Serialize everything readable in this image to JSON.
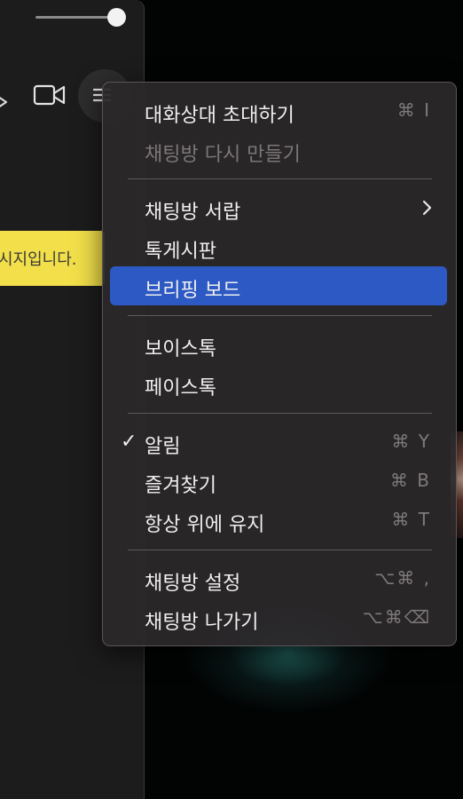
{
  "colors": {
    "menu_bg": "#2c282a",
    "highlight": "#2d59c4",
    "bubble": "#f2df4a",
    "chat_bg": "#1c1c1c"
  },
  "chat": {
    "bubble_text": "시지입니다.",
    "volume_level": 0.88
  },
  "menu": {
    "items": [
      {
        "label": "대화상대 초대하기",
        "shortcut": "⌘ I"
      },
      {
        "label": "채팅방 다시 만들기",
        "shortcut": ""
      },
      {
        "label": "채팅방 서랍",
        "shortcut": ""
      },
      {
        "label": "톡게시판",
        "shortcut": ""
      },
      {
        "label": "브리핑 보드",
        "shortcut": ""
      },
      {
        "label": "보이스톡",
        "shortcut": ""
      },
      {
        "label": "페이스톡",
        "shortcut": ""
      },
      {
        "label": "알림",
        "shortcut": "⌘ Y",
        "check": "✓"
      },
      {
        "label": "즐겨찾기",
        "shortcut": "⌘ B"
      },
      {
        "label": "항상 위에 유지",
        "shortcut": "⌘ T"
      },
      {
        "label": "채팅방 설정",
        "shortcut": "⌥⌘ ,"
      },
      {
        "label": "채팅방 나가기",
        "shortcut": "⌥⌘⌫"
      }
    ]
  }
}
